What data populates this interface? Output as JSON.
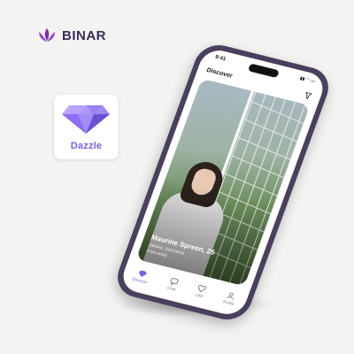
{
  "brand": {
    "name": "BINAR"
  },
  "app": {
    "name": "Dazzle"
  },
  "phone": {
    "status_time": "9:41",
    "header_title": "Discover",
    "profile": {
      "name_age": "Maurine Spreen, 25",
      "location": "Jakarta, Indonesia",
      "distance": "4 km away"
    },
    "tabs": [
      {
        "label": "Discover",
        "icon": "diamond-icon"
      },
      {
        "label": "Chat",
        "icon": "chat-icon"
      },
      {
        "label": "Like",
        "icon": "heart-icon"
      },
      {
        "label": "Profile",
        "icon": "user-icon"
      }
    ]
  },
  "colors": {
    "brand_purple": "#7b5ee0",
    "brand_text": "#3b2d55",
    "phone_frame": "#4a3f5c"
  }
}
